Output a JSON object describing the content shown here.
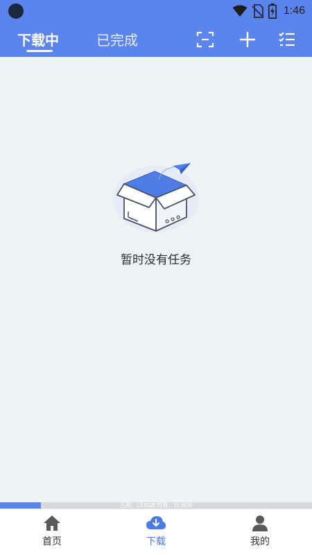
{
  "status_bar": {
    "time": "1:46"
  },
  "tabs": [
    {
      "label": "下载中",
      "active": true
    },
    {
      "label": "已完成",
      "active": false
    }
  ],
  "toolbar": {
    "icons": [
      "scan-icon",
      "add-icon",
      "checklist-icon"
    ]
  },
  "empty_state": {
    "message": "暂时没有任务",
    "icon": "empty-box-icon"
  },
  "storage": {
    "text": "已用：13.5GB 可用：15.6GB",
    "used_fraction": 0.13
  },
  "bottom_nav": [
    {
      "label": "首页",
      "icon": "home-icon",
      "active": false
    },
    {
      "label": "下载",
      "icon": "cloud-download-icon",
      "active": true
    },
    {
      "label": "我的",
      "icon": "user-icon",
      "active": false
    }
  ],
  "colors": {
    "accent": "#5b84ec",
    "background": "#eef3f5",
    "nav_active": "#4a7ae3"
  }
}
